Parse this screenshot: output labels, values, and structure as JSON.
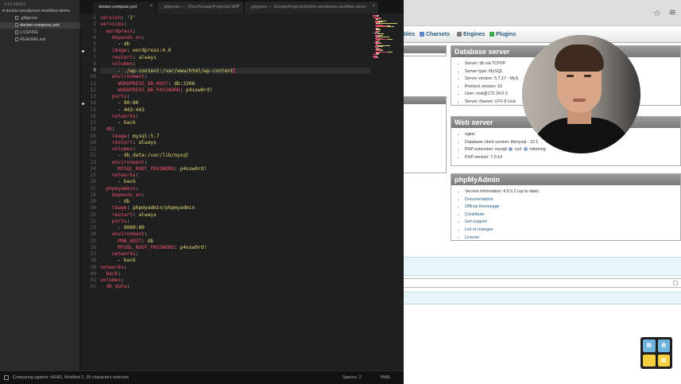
{
  "sidebar": {
    "header": "FOLDERS",
    "folder": "docker-wordpress-workflow-demo",
    "files": [
      ".gitignore",
      "docker-compose.yml",
      "LICENSE",
      "README.md"
    ],
    "active_file": "docker-compose.yml"
  },
  "tabs": [
    {
      "label": "docker-compose.yml",
      "active": true
    },
    {
      "label": ".gitignore — ~/Dev/ScoopicProjects/CMS",
      "active": false
    },
    {
      "label": ".gitignore — ScoopicProjects/docker-wordpress-workflow-demo",
      "active": false
    }
  ],
  "editor": {
    "current_line": 9,
    "modified_lines": [
      6,
      14
    ],
    "lines": [
      [
        [
          "k",
          "version"
        ],
        [
          "p",
          ": "
        ],
        [
          "v",
          "'2'"
        ]
      ],
      [
        [
          "k",
          "services"
        ],
        [
          "p",
          ":"
        ]
      ],
      [
        [
          "p",
          "  "
        ],
        [
          "k",
          "wordpress"
        ],
        [
          "p",
          ":"
        ]
      ],
      [
        [
          "p",
          "    "
        ],
        [
          "k",
          "depends_on"
        ],
        [
          "p",
          ":"
        ]
      ],
      [
        [
          "p",
          "      - "
        ],
        [
          "v",
          "db"
        ]
      ],
      [
        [
          "p",
          "    "
        ],
        [
          "k",
          "image"
        ],
        [
          "p",
          ": "
        ],
        [
          "v",
          "wordpress:4.6"
        ]
      ],
      [
        [
          "p",
          "    "
        ],
        [
          "k",
          "restart"
        ],
        [
          "p",
          ": "
        ],
        [
          "v",
          "always"
        ]
      ],
      [
        [
          "p",
          "    "
        ],
        [
          "k",
          "volumes"
        ],
        [
          "p",
          ":"
        ]
      ],
      [
        [
          "p",
          "      - "
        ],
        [
          "v",
          "./wp-content:/var/www/html/wp-content"
        ]
      ],
      [
        [
          "p",
          "    "
        ],
        [
          "k",
          "environment"
        ],
        [
          "p",
          ":"
        ]
      ],
      [
        [
          "p",
          "      "
        ],
        [
          "k",
          "WORDPRESS_DB_HOST"
        ],
        [
          "p",
          ": "
        ],
        [
          "v",
          "db:3306"
        ]
      ],
      [
        [
          "p",
          "      "
        ],
        [
          "k",
          "WORDPRESS_DB_PASSWORD"
        ],
        [
          "p",
          ": "
        ],
        [
          "v",
          "p4ssw0rd!"
        ]
      ],
      [
        [
          "p",
          "    "
        ],
        [
          "k",
          "ports"
        ],
        [
          "p",
          ":"
        ]
      ],
      [
        [
          "p",
          "      - "
        ],
        [
          "v",
          "80:80"
        ]
      ],
      [
        [
          "p",
          "      - "
        ],
        [
          "v",
          "443:443"
        ]
      ],
      [
        [
          "p",
          "    "
        ],
        [
          "k",
          "networks"
        ],
        [
          "p",
          ":"
        ]
      ],
      [
        [
          "p",
          "      - "
        ],
        [
          "v",
          "back"
        ]
      ],
      [
        [
          "p",
          "  "
        ],
        [
          "k",
          "db"
        ],
        [
          "p",
          ":"
        ]
      ],
      [
        [
          "p",
          "    "
        ],
        [
          "k",
          "image"
        ],
        [
          "p",
          ": "
        ],
        [
          "v",
          "mysql:5.7"
        ]
      ],
      [
        [
          "p",
          "    "
        ],
        [
          "k",
          "restart"
        ],
        [
          "p",
          ": "
        ],
        [
          "v",
          "always"
        ]
      ],
      [
        [
          "p",
          "    "
        ],
        [
          "k",
          "volumes"
        ],
        [
          "p",
          ":"
        ]
      ],
      [
        [
          "p",
          "      - "
        ],
        [
          "v",
          "db_data:/var/lib/mysql"
        ]
      ],
      [
        [
          "p",
          "    "
        ],
        [
          "k",
          "environment"
        ],
        [
          "p",
          ":"
        ]
      ],
      [
        [
          "p",
          "      "
        ],
        [
          "k",
          "MYSQL_ROOT_PASSWORD"
        ],
        [
          "p",
          ": "
        ],
        [
          "v",
          "p4ssw0rd!"
        ]
      ],
      [
        [
          "p",
          "    "
        ],
        [
          "k",
          "networks"
        ],
        [
          "p",
          ":"
        ]
      ],
      [
        [
          "p",
          "      - "
        ],
        [
          "v",
          "back"
        ]
      ],
      [
        [
          "p",
          "  "
        ],
        [
          "k",
          "phpmyadmin"
        ],
        [
          "p",
          ":"
        ]
      ],
      [
        [
          "p",
          "    "
        ],
        [
          "k",
          "depends_on"
        ],
        [
          "p",
          ":"
        ]
      ],
      [
        [
          "p",
          "      - "
        ],
        [
          "v",
          "db"
        ]
      ],
      [
        [
          "p",
          "    "
        ],
        [
          "k",
          "image"
        ],
        [
          "p",
          ": "
        ],
        [
          "v",
          "phpmyadmin/phpmyadmin"
        ]
      ],
      [
        [
          "p",
          "    "
        ],
        [
          "k",
          "restart"
        ],
        [
          "p",
          ": "
        ],
        [
          "v",
          "always"
        ]
      ],
      [
        [
          "p",
          "    "
        ],
        [
          "k",
          "ports"
        ],
        [
          "p",
          ":"
        ]
      ],
      [
        [
          "p",
          "      - "
        ],
        [
          "v",
          "8080:80"
        ]
      ],
      [
        [
          "p",
          "    "
        ],
        [
          "k",
          "environment"
        ],
        [
          "p",
          ":"
        ]
      ],
      [
        [
          "p",
          "      "
        ],
        [
          "k",
          "PMA_HOST"
        ],
        [
          "p",
          ": "
        ],
        [
          "v",
          "db"
        ]
      ],
      [
        [
          "p",
          "      "
        ],
        [
          "k",
          "MYSQL_ROOT_PASSWORD"
        ],
        [
          "p",
          ": "
        ],
        [
          "v",
          "p4ssw0rd!"
        ]
      ],
      [
        [
          "p",
          "    "
        ],
        [
          "k",
          "networks"
        ],
        [
          "p",
          ":"
        ]
      ],
      [
        [
          "p",
          "      - "
        ],
        [
          "v",
          "back"
        ]
      ],
      [
        [
          "k",
          "networks"
        ],
        [
          "p",
          ":"
        ]
      ],
      [
        [
          "p",
          "  "
        ],
        [
          "k",
          "back"
        ],
        [
          "p",
          ":"
        ]
      ],
      [
        [
          "k",
          "volumes"
        ],
        [
          "p",
          ":"
        ]
      ],
      [
        [
          "p",
          "  "
        ],
        [
          "k",
          "db_data"
        ],
        [
          "p",
          ":"
        ]
      ]
    ]
  },
  "statusbar": {
    "left": "Comparing against: HEAD, Modified  2, 39 characters selected",
    "spaces": "Spaces: 2",
    "syntax": "YAML"
  },
  "phpmyadmin": {
    "tabs": [
      "bles",
      "Charsets",
      "Engines",
      "Plugins"
    ],
    "database_server": {
      "title": "Database server",
      "items": [
        "Server: db via TCP/IP",
        "Server type: MySQL",
        "Server version: 5.7.17 - MyS",
        "Protocol version: 10",
        "User: root@172.24.0.3",
        "Server charset: UTF-8 Unic"
      ]
    },
    "web_server": {
      "title": "Web server",
      "items": [
        "nginx",
        "Database client version: libmysql - 10.1.",
        "PHP extension: mysqli",
        "PHP version: 7.0.14"
      ],
      "ext_labels": [
        "curl",
        "mbstring"
      ]
    },
    "phpmyadmin_panel": {
      "title": "phpMyAdmin",
      "version": "Version information: 4.6.5.2 (up to date)",
      "links": [
        "Documentation",
        "Official Homepage",
        "Contribute",
        "Get support",
        "List of changes",
        "License"
      ]
    }
  },
  "logo": {
    "letters": [
      "m",
      "e",
      "",
      "m"
    ],
    "colors": [
      "#6fb4dc",
      "#6fb4dc",
      "#f4d03f",
      "#f4d03f"
    ]
  },
  "icons": {
    "star": "☆",
    "menu": "≡",
    "close": "×"
  }
}
